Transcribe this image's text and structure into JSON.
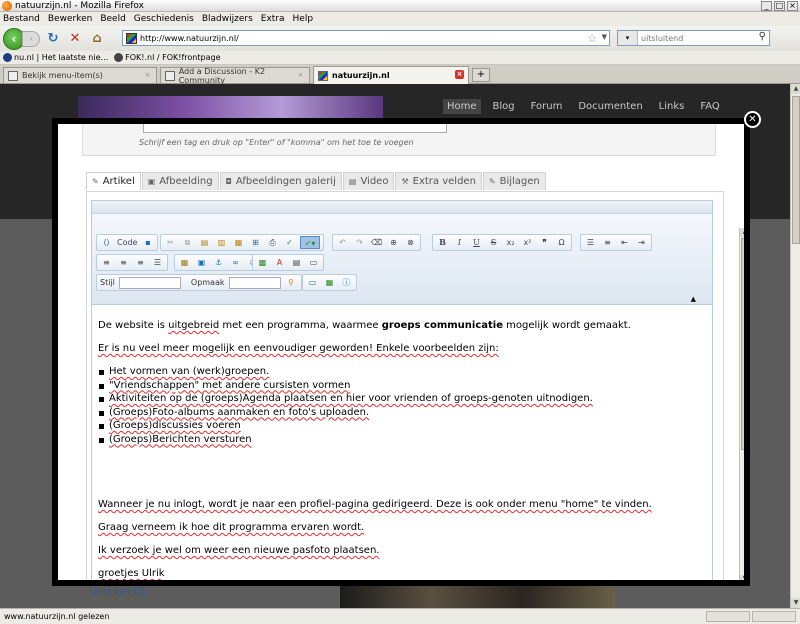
{
  "window": {
    "title": "natuurzijn.nl - Mozilla Firefox",
    "controls": [
      "_",
      "□",
      "×"
    ]
  },
  "menu": [
    "Bestand",
    "Bewerken",
    "Beeld",
    "Geschiedenis",
    "Bladwijzers",
    "Extra",
    "Help"
  ],
  "nav": {
    "url": "http://www.natuurzijn.nl/",
    "search_placeholder": "uitsluitend"
  },
  "bookmarks": [
    "nu.nl | Het laatste nie...",
    "FOK!.nl / FOK!frontpage"
  ],
  "tabs": [
    {
      "label": "Bekijk menu-item(s)"
    },
    {
      "label": "Add a Discussion - K2 Community"
    },
    {
      "label": "natuurzijn.nl",
      "active": true
    }
  ],
  "site": {
    "nav": [
      "Home",
      "Blog",
      "Forum",
      "Documenten",
      "Links",
      "FAQ"
    ],
    "side_link": "Ours van CS"
  },
  "tags": {
    "hint": "Schrijf een tag en druk op \"Enter\" of \"komma\" om het toe te voegen"
  },
  "editor_tabs": [
    {
      "label": "Artikel",
      "icon": "edit-icon"
    },
    {
      "label": "Afbeelding",
      "icon": "image-icon"
    },
    {
      "label": "Afbeeldingen galerij",
      "icon": "camera-icon"
    },
    {
      "label": "Video",
      "icon": "film-icon"
    },
    {
      "label": "Extra velden",
      "icon": "fields-icon"
    },
    {
      "label": "Bijlagen",
      "icon": "paperclip-icon"
    }
  ],
  "toolbar": {
    "code_label": "Code",
    "style_label": "Stijl",
    "format_label": "Opmaak"
  },
  "content": {
    "p1_a": "De website is ",
    "p1_b": "uitgebreid",
    "p1_c": " met een programma, waarmee ",
    "p1_d": "groeps communicatie",
    "p1_e": " mogelijk wordt gemaakt.",
    "p2": "Er is nu veel meer mogelijk en eenvoudiger geworden! Enkele voorbeelden zijn:",
    "list": [
      "Het vormen van (werk)groepen.",
      "\"Vriendschappen\" met andere cursisten vormen",
      "Aktiviteiten op de (groeps)Agenda plaatsen en hier voor vrienden of groeps-genoten uitnodigen.",
      "(Groeps)Foto-albums aanmaken en foto's uploaden.",
      "(Groeps)discussies voeren",
      "(Groeps)Berichten versturen"
    ],
    "p3": "Wanneer je nu inlogt, wordt je naar een profiel-pagina gedirigeerd. Deze is ook onder menu \"home\" te vinden.",
    "p4": "Graag verneem ik hoe dit programma ervaren wordt.",
    "p5": "Ik verzoek je wel om weer een nieuwe pasfoto plaatsen.",
    "p6": "groetjes Ulrik"
  },
  "status": {
    "text": "www.natuurzijn.nl gelezen"
  }
}
